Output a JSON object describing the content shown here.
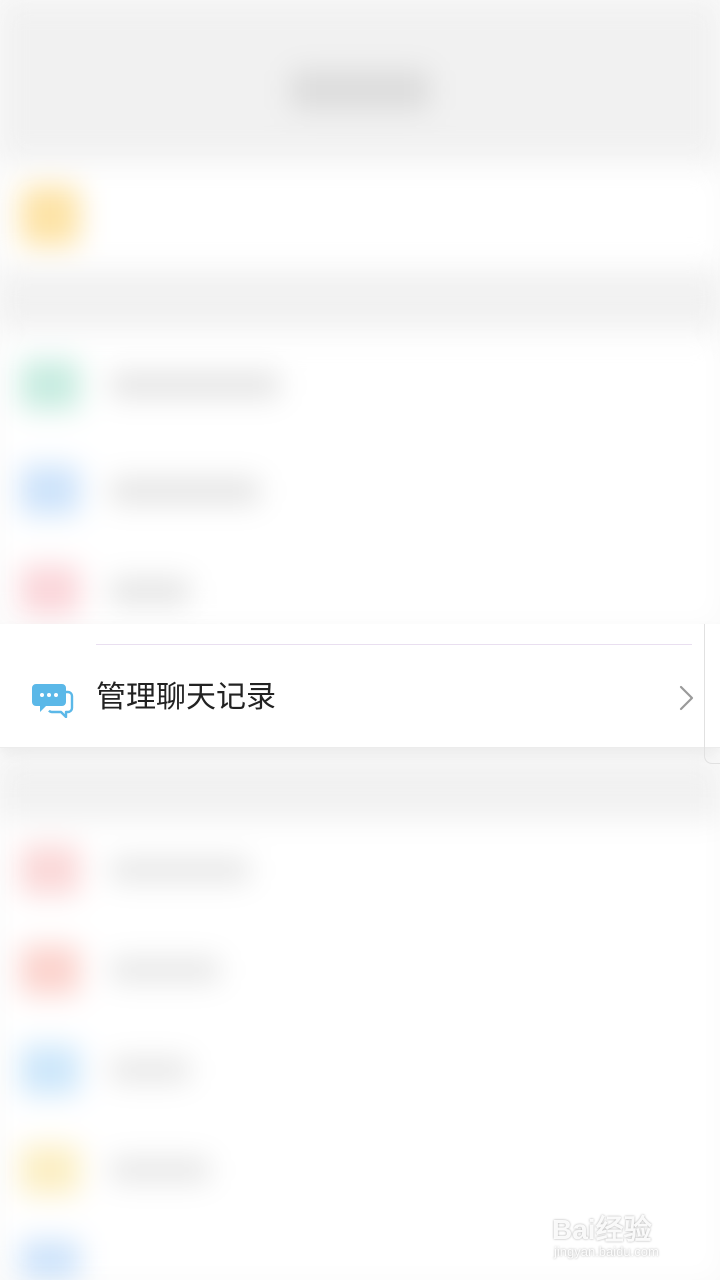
{
  "focused_item": {
    "label": "管理聊天记录",
    "icon": "chat-bubbles-icon",
    "accent_color": "#5bb8e8"
  },
  "watermark": {
    "brand": "Bai经验",
    "url": "jingyan.baidu.com"
  }
}
